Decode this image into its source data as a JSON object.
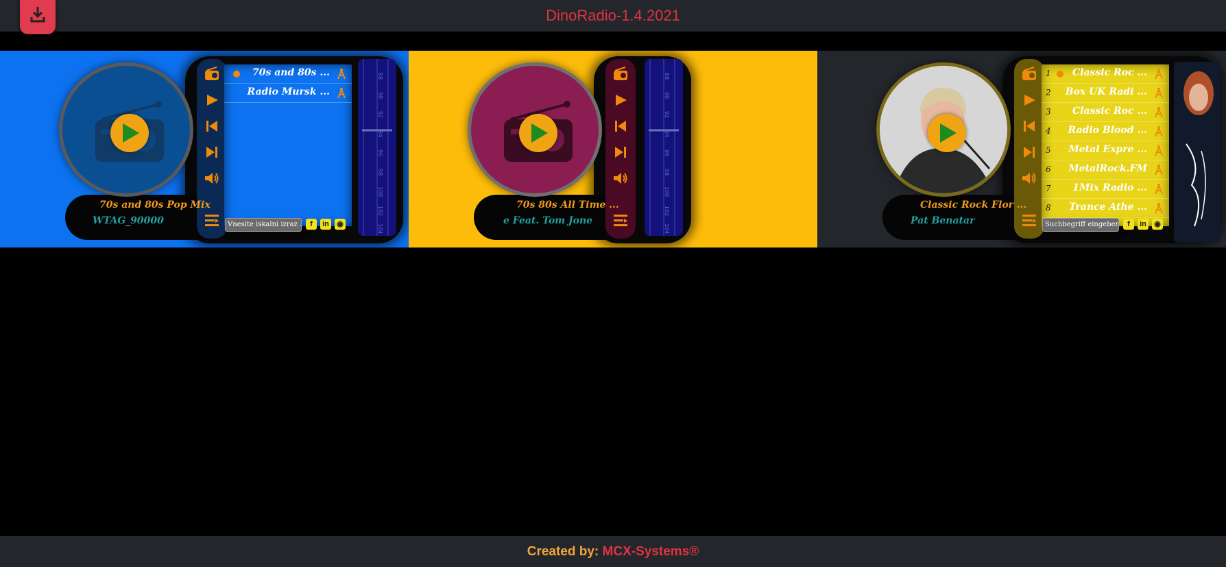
{
  "header": {
    "title": "DinoRadio-1.4.2021"
  },
  "footer": {
    "label": "Created by:",
    "brand": "MCX-Systems®"
  },
  "players": [
    {
      "background": "#0d72f0",
      "station": "70s and 80s Pop Mix",
      "artist": "WTAG_90000",
      "playlist": [
        {
          "name": "70s and 80s ..."
        },
        {
          "name": "Radio Mursk ..."
        }
      ],
      "search_placeholder": "Vnesite iskalni izraz ..."
    },
    {
      "background": "#fdbc0a",
      "station": "70s 80s All Time ...",
      "artist": "e Feat. Tom Jones"
    },
    {
      "background": "#23262b",
      "station": "Classic Rock Flor ...",
      "artist": "Pat Benatar",
      "playlist": [
        {
          "num": "1",
          "name": "Classic Roc ..."
        },
        {
          "num": "2",
          "name": "Box UK Radi ..."
        },
        {
          "num": "3",
          "name": "Classic Roc ..."
        },
        {
          "num": "4",
          "name": "Radio Blood ..."
        },
        {
          "num": "5",
          "name": "Metal Expre ..."
        },
        {
          "num": "6",
          "name": "MetalRock.FM"
        },
        {
          "num": "7",
          "name": "1Mix Radio ..."
        },
        {
          "num": "8",
          "name": "Trance Athe ..."
        }
      ],
      "search_placeholder": "Suchbegriff eingeben ..."
    }
  ],
  "tuner_scale": [
    "88",
    "90",
    "92",
    "94",
    "96",
    "98",
    "100",
    "102",
    "104"
  ],
  "icons": [
    "download-icon",
    "radio-icon",
    "play-icon",
    "prev-icon",
    "next-icon",
    "volume-icon",
    "playlist-icon",
    "antenna-icon",
    "facebook-icon",
    "linkedin-icon",
    "github-icon"
  ]
}
